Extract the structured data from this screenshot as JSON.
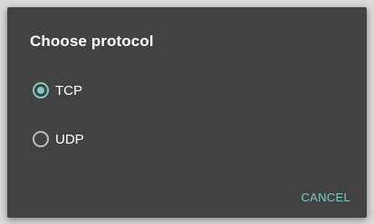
{
  "dialog": {
    "title": "Choose protocol",
    "options": [
      {
        "label": "TCP",
        "selected": true
      },
      {
        "label": "UDP",
        "selected": false
      }
    ],
    "cancel_label": "CANCEL"
  },
  "colors": {
    "dialog_background": "#424242",
    "accent": "#80cbc4",
    "text": "#ffffff"
  }
}
